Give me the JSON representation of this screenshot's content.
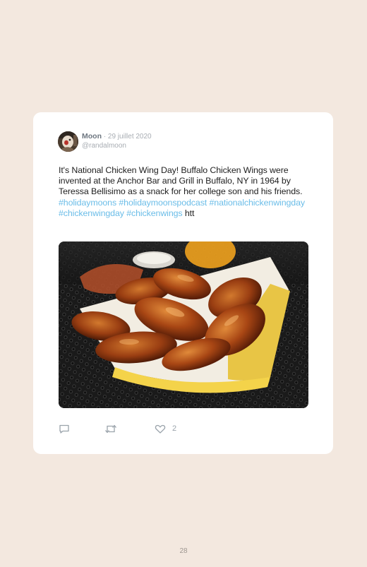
{
  "tweet": {
    "author_name": "Moon",
    "separator": "·",
    "date": "29 juillet 2020",
    "handle": "@randalmoon",
    "text_segments": [
      {
        "text": "It's National Chicken Wing Day! Buffalo Chicken Wings were invented at the Anchor Bar and Grill in Buffalo, NY in 1964 by Teressa Bellisimo as a snack for her college son and his friends. ",
        "is_hashtag": false
      },
      {
        "text": "#holidaymoons",
        "is_hashtag": true
      },
      {
        "text": " ",
        "is_hashtag": false
      },
      {
        "text": "#holidaymoonspodcast",
        "is_hashtag": true
      },
      {
        "text": " ",
        "is_hashtag": false
      },
      {
        "text": "#nationalchickenwingday",
        "is_hashtag": true
      },
      {
        "text": " ",
        "is_hashtag": false
      },
      {
        "text": "#chickenwingday",
        "is_hashtag": true
      },
      {
        "text": " ",
        "is_hashtag": false
      },
      {
        "text": "#chickenwings",
        "is_hashtag": true
      },
      {
        "text": " htt",
        "is_hashtag": false
      }
    ],
    "actions": {
      "reply_icon": "reply-icon",
      "retweet_icon": "retweet-icon",
      "like_icon": "heart-icon",
      "like_count": "2"
    }
  },
  "page_number": "28",
  "colors": {
    "background": "#f3e8df",
    "card": "#ffffff",
    "hashtag": "#6bbde8",
    "muted": "#a8adb3"
  }
}
